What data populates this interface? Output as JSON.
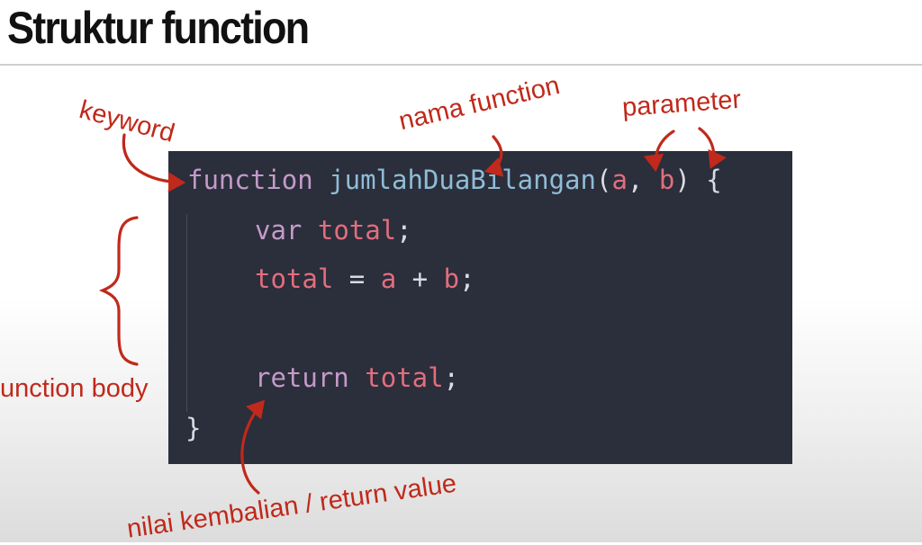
{
  "slide": {
    "title": "Struktur function"
  },
  "code": {
    "line1": {
      "keyword": "function",
      "name": "jumlahDuaBilangan",
      "open_paren": "(",
      "param_a": "a",
      "comma": ",",
      "param_b": "b",
      "close": ") {"
    },
    "line2": {
      "keyword": "var",
      "variable": "total",
      "semicolon": ";"
    },
    "line3": {
      "lhs": "total",
      "eq": "=",
      "a": "a",
      "plus": "+",
      "b": "b",
      "semicolon": ";"
    },
    "line4": {
      "keyword": "return",
      "variable": "total",
      "semicolon": ";"
    },
    "line5": {
      "close_brace": "}"
    }
  },
  "annotations": {
    "keyword": "keyword",
    "nama_function": "nama function",
    "parameter": "parameter",
    "function_body": "unction body",
    "return_value": "nilai kembalian / return value"
  },
  "colors": {
    "annotation": "#c0291b",
    "code_background": "#2b2e3b",
    "keyword": "#c39ac9",
    "function_name": "#8fbcd6",
    "variable": "#e26e7e"
  }
}
